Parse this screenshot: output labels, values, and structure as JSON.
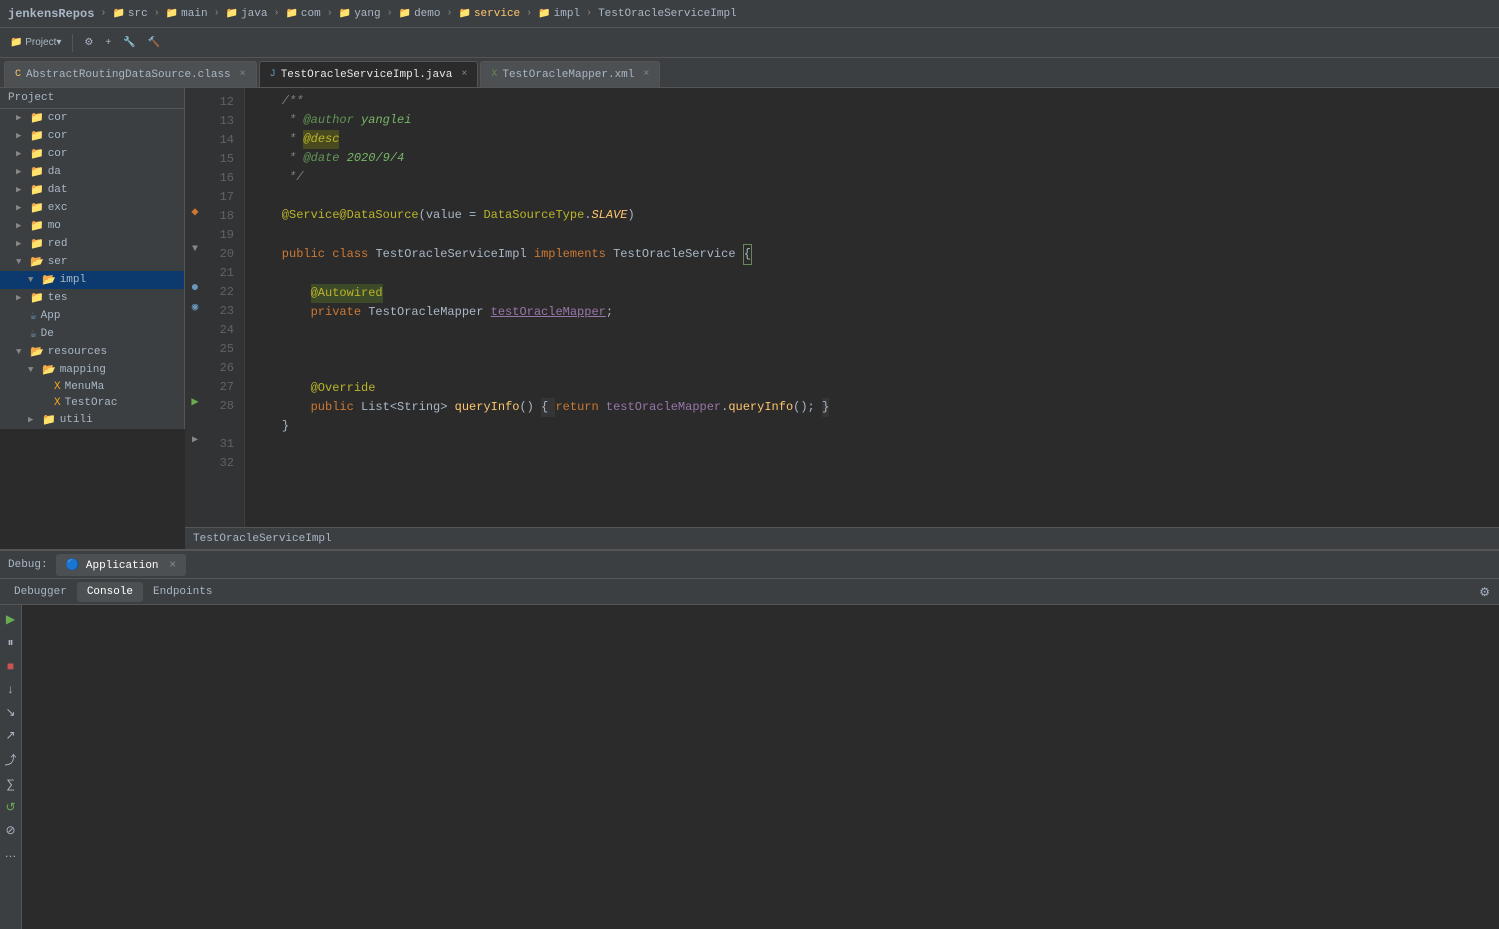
{
  "topbar": {
    "title": "jenkensRepos",
    "breadcrumbs": [
      "src",
      "main",
      "java",
      "com",
      "yang",
      "demo",
      "service",
      "impl",
      "TestOracleServiceImpl"
    ]
  },
  "tabs": [
    {
      "label": "AbstractRoutingDataSource.class",
      "type": "class",
      "active": false,
      "closable": true
    },
    {
      "label": "TestOracleServiceImpl.java",
      "type": "java",
      "active": true,
      "closable": true
    },
    {
      "label": "TestOracleMapper.xml",
      "type": "xml",
      "active": false,
      "closable": true
    }
  ],
  "sidebar": {
    "header": "Project",
    "items": [
      {
        "indent": 1,
        "label": "cor",
        "type": "folder",
        "arrow": "▶"
      },
      {
        "indent": 1,
        "label": "cor",
        "type": "folder",
        "arrow": "▶"
      },
      {
        "indent": 1,
        "label": "cor",
        "type": "folder",
        "arrow": "▶"
      },
      {
        "indent": 1,
        "label": "da",
        "type": "folder",
        "arrow": "▶"
      },
      {
        "indent": 1,
        "label": "dat",
        "type": "folder",
        "arrow": "▶"
      },
      {
        "indent": 1,
        "label": "exc",
        "type": "folder",
        "arrow": "▶"
      },
      {
        "indent": 1,
        "label": "mo",
        "type": "folder",
        "arrow": "▶"
      },
      {
        "indent": 1,
        "label": "red",
        "type": "folder",
        "arrow": "▶"
      },
      {
        "indent": 1,
        "label": "ser",
        "type": "folder",
        "arrow": "▼",
        "expanded": true
      },
      {
        "indent": 2,
        "label": "impl",
        "type": "folder",
        "arrow": "▼",
        "expanded": true
      },
      {
        "indent": 1,
        "label": "tes",
        "type": "folder",
        "arrow": "▶"
      },
      {
        "indent": 1,
        "label": "App",
        "type": "java",
        "icon": "☕"
      },
      {
        "indent": 1,
        "label": "De",
        "type": "java",
        "icon": "☕"
      }
    ]
  },
  "resources": {
    "label": "resources",
    "children": [
      {
        "label": "mapping",
        "type": "folder",
        "children": [
          {
            "label": "MenuMa",
            "type": "xml"
          },
          {
            "label": "TestOrac",
            "type": "xml"
          }
        ]
      },
      {
        "label": "utili",
        "type": "folder"
      }
    ]
  },
  "code": {
    "lines": [
      {
        "num": 12,
        "content": "/**",
        "type": "comment"
      },
      {
        "num": 13,
        "content": " * @author yanglei",
        "type": "comment-tag"
      },
      {
        "num": 14,
        "content": " * @desc",
        "type": "comment-desc"
      },
      {
        "num": 15,
        "content": " * @date 2020/9/4",
        "type": "comment-tag"
      },
      {
        "num": 16,
        "content": " */",
        "type": "comment"
      },
      {
        "num": 17,
        "content": "",
        "type": "blank"
      },
      {
        "num": 18,
        "content": "@Service@DataSource(value = DataSourceType.SLAVE)",
        "type": "annotation"
      },
      {
        "num": 19,
        "content": "",
        "type": "blank"
      },
      {
        "num": 20,
        "content": "public class TestOracleServiceImpl implements TestOracleService {",
        "type": "class-decl"
      },
      {
        "num": 21,
        "content": "",
        "type": "blank"
      },
      {
        "num": 22,
        "content": "    @Autowired",
        "type": "annotation-inner"
      },
      {
        "num": 23,
        "content": "    private TestOracleMapper testOracleMapper;",
        "type": "field"
      },
      {
        "num": 24,
        "content": "",
        "type": "blank"
      },
      {
        "num": 25,
        "content": "",
        "type": "blank"
      },
      {
        "num": 26,
        "content": "",
        "type": "blank"
      },
      {
        "num": 27,
        "content": "    @Override",
        "type": "annotation-inner"
      },
      {
        "num": 28,
        "content": "    public List<String> queryInfo() { return testOracleMapper.queryInfo(); }",
        "type": "method"
      },
      {
        "num": 31,
        "content": "}",
        "type": "brace"
      },
      {
        "num": 32,
        "content": "",
        "type": "blank"
      }
    ]
  },
  "editor_status": {
    "file": "TestOracleServiceImpl"
  },
  "debug": {
    "label": "Debug:",
    "session": "Application",
    "tabs": [
      "Debugger",
      "Console",
      "Endpoints"
    ],
    "active_tab": "Console",
    "toolbar_buttons": [
      "▶",
      "⏸",
      "⏹",
      "↓",
      "↑",
      "→",
      "↗",
      "⤴",
      "↙",
      "■",
      "≡≡"
    ]
  }
}
